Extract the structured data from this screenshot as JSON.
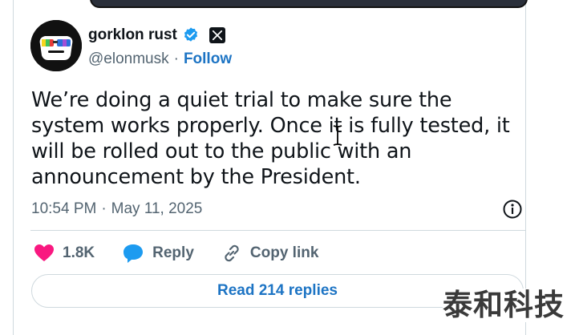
{
  "author": {
    "name": "gorklon rust",
    "handle": "@elonmusk",
    "separator": "·",
    "follow_label": "Follow"
  },
  "tweet": {
    "text": "We’re doing a quiet trial to make sure the system works properly. Once it is fully tested, it will be rolled out to the public with an announcement by the President.",
    "time": "10:54 PM",
    "separator": "·",
    "date": "May 11, 2025"
  },
  "actions": {
    "like_count": "1.8K",
    "reply_label": "Reply",
    "copy_link_label": "Copy link"
  },
  "read_replies_label": "Read 214 replies",
  "watermark_text": "泰和科技",
  "colors": {
    "accent": "#1d74c4",
    "like": "#f91880",
    "verified": "#1d9bf0",
    "secondary_text": "#536471"
  },
  "icons": {
    "avatar": "sunglasses-avatar",
    "verified": "verified-badge-icon",
    "platform": "x-logo-icon",
    "info": "info-icon",
    "like": "heart-icon",
    "reply": "speech-bubble-icon",
    "copy": "link-icon"
  }
}
